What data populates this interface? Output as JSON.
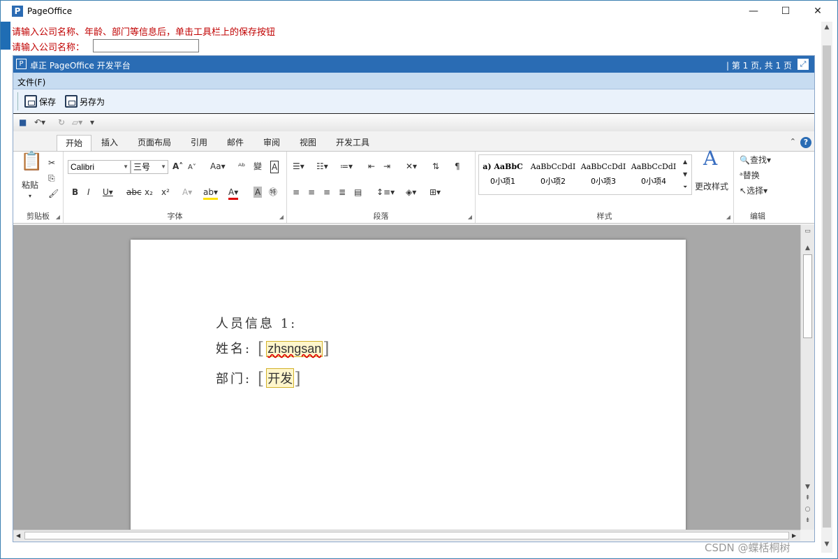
{
  "window": {
    "title": "PageOffice",
    "min": "—",
    "max": "☐",
    "close": "✕"
  },
  "instructions": {
    "text": "请输入公司名称、年龄、部门等信息后，单击工具栏上的保存按钮",
    "company_label": "请输入公司名称：",
    "company_value": ""
  },
  "po": {
    "title": "卓正 PageOffice 开发平台",
    "page_info": "| 第 1 页, 共 1 页",
    "menu_file": "文件(F)",
    "save": "保存",
    "save_as": "另存为"
  },
  "word": {
    "tabs": [
      "开始",
      "插入",
      "页面布局",
      "引用",
      "邮件",
      "审阅",
      "视图",
      "开发工具"
    ],
    "groups": {
      "clipboard": "剪贴板",
      "font": "字体",
      "paragraph": "段落",
      "styles": "样式",
      "editing": "编辑"
    },
    "paste": "粘贴",
    "font_name": "Calibri",
    "font_size": "三号",
    "styles": [
      {
        "sample": "a) AaBbC",
        "name": "0小项1"
      },
      {
        "sample": "AaBbCcDdI",
        "name": "0小项2"
      },
      {
        "sample": "AaBbCcDdI",
        "name": "0小项3"
      },
      {
        "sample": "AaBbCcDdI",
        "name": "0小项4"
      }
    ],
    "change_styles": "更改样式",
    "find": "查找",
    "replace": "替换",
    "select": "选择"
  },
  "document": {
    "heading": "人员信息 1:",
    "name_label": "姓名:",
    "name_value": "zhsngsan",
    "dept_label": "部门:",
    "dept_value": "开发"
  },
  "watermark": "CSDN @蝶栝桐树",
  "colors": {
    "accent": "#2a6cb4",
    "instruction": "#c00000"
  }
}
